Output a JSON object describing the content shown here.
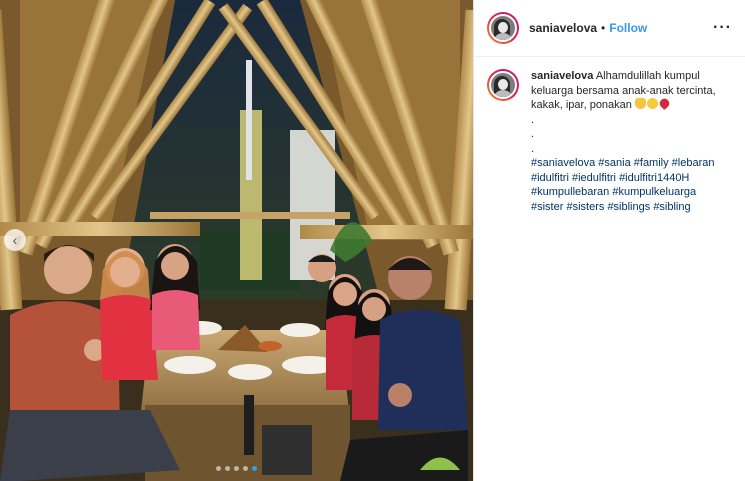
{
  "post": {
    "username": "saniavelova",
    "separator": "•",
    "follow_label": "Follow",
    "more_icon": "more-options-icon",
    "caption": {
      "username": "saniavelova",
      "text": "Alhamdulillah kumpul keluarga bersama anak-anak tercinta, kakak, ipar, ponakan",
      "emojis": [
        "folded-hands-emoji",
        "smiling-face-emoji",
        "red-heart-emoji"
      ],
      "dot_lines": [
        ".",
        ".",
        "."
      ],
      "hashtags": [
        "#saniavelova",
        "#sania",
        "#family",
        "#lebaran",
        "#idulfitri",
        "#iedulfitri",
        "#idulfitri1440H",
        "#kumpullebaran",
        "#kumpulkeluarga",
        "#sister",
        "#sisters",
        "#siblings",
        "#sibling"
      ]
    },
    "carousel": {
      "slides": 5,
      "active_index": 4
    },
    "colors": {
      "follow": "#3897f0",
      "hashtag": "#003569",
      "text": "#262626",
      "active_dot": "#2f9ff0"
    }
  }
}
